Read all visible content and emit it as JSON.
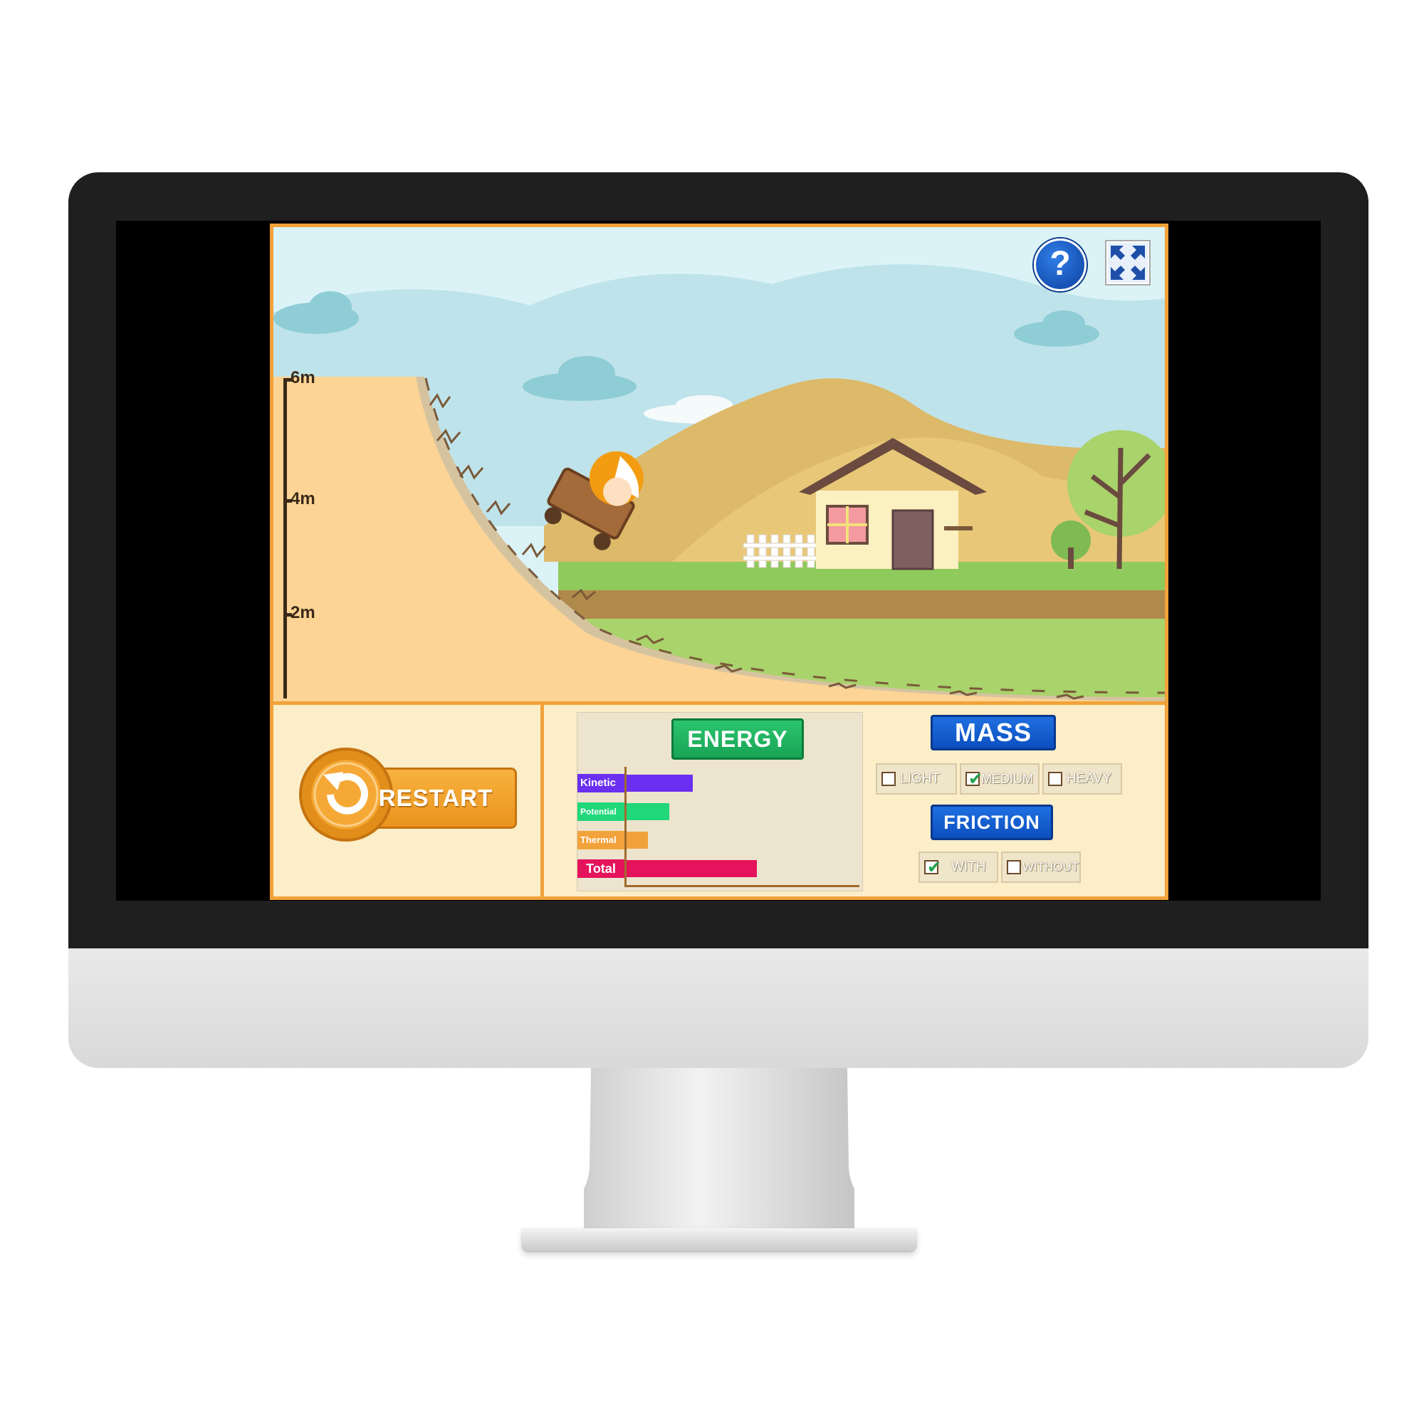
{
  "scale": {
    "labels": [
      "6m",
      "4m",
      "2m"
    ]
  },
  "toolbar": {
    "help_glyph": "?",
    "fullscreen_label": ""
  },
  "restart": {
    "label": "RESTART"
  },
  "energy": {
    "title": "ENERGY",
    "bars": [
      {
        "label": "Kinetic",
        "value": 0.31,
        "color": "#6a2ff0"
      },
      {
        "label": "Potential",
        "value": 0.2,
        "color": "#20d77a"
      },
      {
        "label": "Thermal",
        "value": 0.1,
        "color": "#f2a23a"
      },
      {
        "label": "Total",
        "value": 0.61,
        "color": "#e5125c"
      }
    ]
  },
  "mass": {
    "title": "MASS",
    "options": [
      {
        "label": "LIGHT",
        "checked": false
      },
      {
        "label": "MEDIUM",
        "checked": true
      },
      {
        "label": "HEAVY",
        "checked": false
      }
    ]
  },
  "friction": {
    "title": "FRICTION",
    "options": [
      {
        "label": "WITH",
        "checked": true
      },
      {
        "label": "WITHOUT",
        "checked": false
      }
    ]
  },
  "colors": {
    "accent_orange": "#f2a23a",
    "panel_bg": "#fbeec8",
    "sky": "#dbf3f7"
  }
}
